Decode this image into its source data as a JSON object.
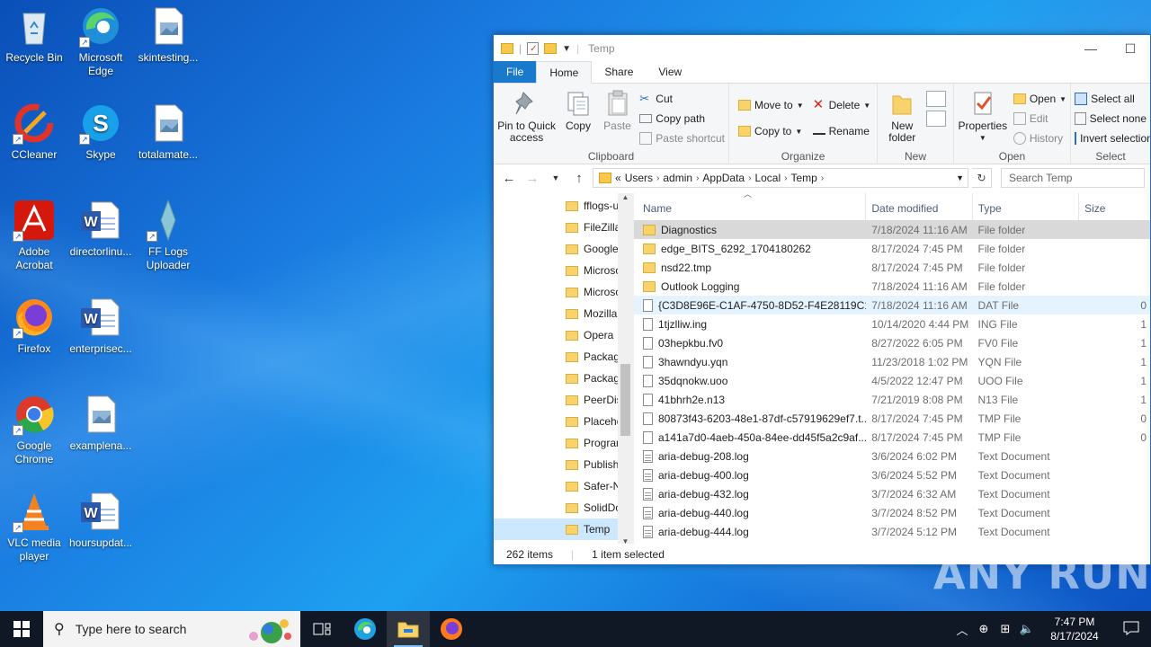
{
  "desktop": {
    "icons": [
      {
        "label": "Recycle Bin",
        "icon": "recycle-bin-icon"
      },
      {
        "label": "Microsoft Edge",
        "icon": "edge-icon"
      },
      {
        "label": "skintesting...",
        "icon": "image-file-icon"
      },
      {
        "label": "CCleaner",
        "icon": "ccleaner-icon"
      },
      {
        "label": "Skype",
        "icon": "skype-icon"
      },
      {
        "label": "totalamate...",
        "icon": "image-file-icon"
      },
      {
        "label": "Adobe Acrobat",
        "icon": "acrobat-icon"
      },
      {
        "label": "directorlinu...",
        "icon": "word-doc-icon"
      },
      {
        "label": "FF Logs Uploader",
        "icon": "fflogs-icon"
      },
      {
        "label": "Firefox",
        "icon": "firefox-icon"
      },
      {
        "label": "enterprisec...",
        "icon": "word-doc-icon"
      },
      {
        "label": "Google Chrome",
        "icon": "chrome-icon"
      },
      {
        "label": "examplena...",
        "icon": "image-file-icon"
      },
      {
        "label": "VLC media player",
        "icon": "vlc-icon"
      },
      {
        "label": "hoursupdat...",
        "icon": "word-doc-icon"
      }
    ]
  },
  "explorer": {
    "title": "Temp",
    "tabs": {
      "file": "File",
      "home": "Home",
      "share": "Share",
      "view": "View"
    },
    "ribbon": {
      "clipboard": {
        "label": "Clipboard",
        "pin": "Pin to Quick access",
        "copy": "Copy",
        "paste": "Paste",
        "cut": "Cut",
        "copy_path": "Copy path",
        "paste_shortcut": "Paste shortcut"
      },
      "organize": {
        "label": "Organize",
        "move_to": "Move to",
        "copy_to": "Copy to",
        "delete": "Delete",
        "rename": "Rename"
      },
      "new": {
        "label": "New",
        "new_folder": "New folder"
      },
      "open": {
        "label": "Open",
        "properties": "Properties",
        "open": "Open",
        "edit": "Edit",
        "history": "History"
      },
      "select": {
        "label": "Select",
        "select_all": "Select all",
        "select_none": "Select none",
        "invert": "Invert selection"
      }
    },
    "address": {
      "prefix": "«",
      "crumbs": [
        "Users",
        "admin",
        "AppData",
        "Local",
        "Temp"
      ],
      "search_placeholder": "Search Temp"
    },
    "nav_items": [
      "fflogs-u",
      "FileZilla",
      "Google",
      "Microsof",
      "Microsof",
      "Mozilla",
      "Opera",
      "Packag",
      "Packag",
      "PeerDis",
      "Placeho",
      "Program",
      "Publish",
      "Safer-N",
      "SolidDo",
      "Temp"
    ],
    "columns": {
      "name": "Name",
      "date": "Date modified",
      "type": "Type",
      "size": "Size"
    },
    "files": [
      {
        "name": "Diagnostics",
        "date": "7/18/2024 11:16 AM",
        "type": "File folder",
        "size": "",
        "kind": "folder"
      },
      {
        "name": "edge_BITS_6292_1704180262",
        "date": "8/17/2024 7:45 PM",
        "type": "File folder",
        "size": "",
        "kind": "folder"
      },
      {
        "name": "nsd22.tmp",
        "date": "8/17/2024 7:45 PM",
        "type": "File folder",
        "size": "",
        "kind": "folder"
      },
      {
        "name": "Outlook Logging",
        "date": "7/18/2024 11:16 AM",
        "type": "File folder",
        "size": "",
        "kind": "folder"
      },
      {
        "name": "{C3D8E96E-C1AF-4750-8D52-F4E28119C1...",
        "date": "7/18/2024 11:16 AM",
        "type": "DAT File",
        "size": "0",
        "kind": "doc"
      },
      {
        "name": "1tjzlliw.ing",
        "date": "10/14/2020 4:44 PM",
        "type": "ING File",
        "size": "1",
        "kind": "doc"
      },
      {
        "name": "03hepkbu.fv0",
        "date": "8/27/2022 6:05 PM",
        "type": "FV0 File",
        "size": "1",
        "kind": "doc"
      },
      {
        "name": "3hawndyu.yqn",
        "date": "11/23/2018 1:02 PM",
        "type": "YQN File",
        "size": "1",
        "kind": "doc"
      },
      {
        "name": "35dqnokw.uoo",
        "date": "4/5/2022 12:47 PM",
        "type": "UOO File",
        "size": "1",
        "kind": "doc"
      },
      {
        "name": "41bhrh2e.n13",
        "date": "7/21/2019 8:08 PM",
        "type": "N13 File",
        "size": "1",
        "kind": "doc"
      },
      {
        "name": "80873f43-6203-48e1-87df-c57919629ef7.t...",
        "date": "8/17/2024 7:45 PM",
        "type": "TMP File",
        "size": "0",
        "kind": "doc"
      },
      {
        "name": "a141a7d0-4aeb-450a-84ee-dd45f5a2c9af....",
        "date": "8/17/2024 7:45 PM",
        "type": "TMP File",
        "size": "0",
        "kind": "doc"
      },
      {
        "name": "aria-debug-208.log",
        "date": "3/6/2024 6:02 PM",
        "type": "Text Document",
        "size": "",
        "kind": "txt"
      },
      {
        "name": "aria-debug-400.log",
        "date": "3/6/2024 5:52 PM",
        "type": "Text Document",
        "size": "",
        "kind": "txt"
      },
      {
        "name": "aria-debug-432.log",
        "date": "3/7/2024 6:32 AM",
        "type": "Text Document",
        "size": "",
        "kind": "txt"
      },
      {
        "name": "aria-debug-440.log",
        "date": "3/7/2024 8:52 PM",
        "type": "Text Document",
        "size": "",
        "kind": "txt"
      },
      {
        "name": "aria-debug-444.log",
        "date": "3/7/2024 5:12 PM",
        "type": "Text Document",
        "size": "",
        "kind": "txt"
      }
    ],
    "status": {
      "items": "262 items",
      "selected": "1 item selected"
    }
  },
  "taskbar": {
    "search_placeholder": "Type here to search",
    "time": "7:47 PM",
    "date": "8/17/2024"
  },
  "watermark": "ANY RUN"
}
